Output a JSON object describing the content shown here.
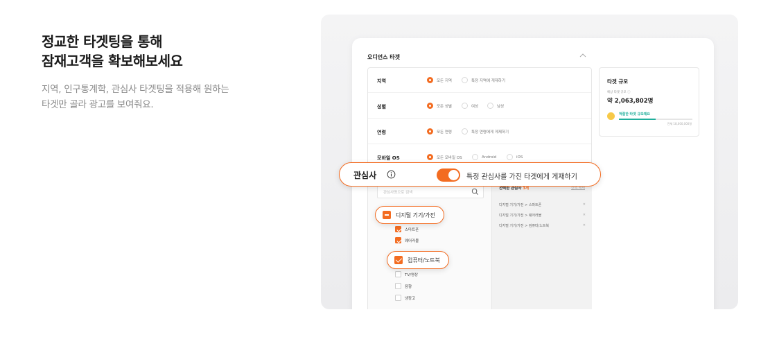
{
  "hero": {
    "title_line1": "정교한 타겟팅을 통해",
    "title_line2": "잠재고객을 확보해보세요",
    "desc_line1": "지역, 인구통계학, 관심사 타겟팅을 적용해 원하는",
    "desc_line2": "타겟만 골라 광고를 보여줘요."
  },
  "panel": {
    "title": "오디언스 타겟",
    "rows": [
      {
        "label": "지역",
        "options": [
          "모든 지역",
          "특정 지역에 게재하기"
        ]
      },
      {
        "label": "성별",
        "options": [
          "모든 성별",
          "여성",
          "남성"
        ]
      },
      {
        "label": "연령",
        "options": [
          "모든 연령",
          "특정 연령에게 게재하기"
        ]
      },
      {
        "label": "모바일 OS",
        "options": [
          "모든 모바일 OS",
          "Android",
          "iOS"
        ]
      }
    ]
  },
  "summary": {
    "title": "타겟 규모",
    "subtitle": "예상 타겟 규모 ⓘ",
    "value": "약 2,063,802명",
    "status": "적절한 타겟 규모예요",
    "fill_fraction": 0.5,
    "total": "전체 18,000,000명"
  },
  "interest": {
    "label": "관심사",
    "toggle_on": true,
    "toggle_text": "특정 관심사를 가진 타겟에게 게재하기",
    "search_placeholder": "관심사명으로 검색",
    "category": "디지털 기기/가전",
    "children": [
      {
        "label": "스마트폰",
        "checked": true
      },
      {
        "label": "웨어러블",
        "checked": true
      },
      {
        "label": "컴퓨터/노트북",
        "checked": true
      },
      {
        "label": "TV/영상",
        "checked": false
      },
      {
        "label": "음향",
        "checked": false
      },
      {
        "label": "냉장고",
        "checked": false
      }
    ],
    "selected_title": "선택한 관심사",
    "selected_count": "3개",
    "clear_label": "선택 해제",
    "selected_items": [
      "디지털 기기/가전 > 스마트폰",
      "디지털 기기/가전 > 웨어러블",
      "디지털 기기/가전 > 컴퓨터/노트북"
    ]
  },
  "colors": {
    "accent": "#f36c21",
    "success": "#1fae9b"
  }
}
